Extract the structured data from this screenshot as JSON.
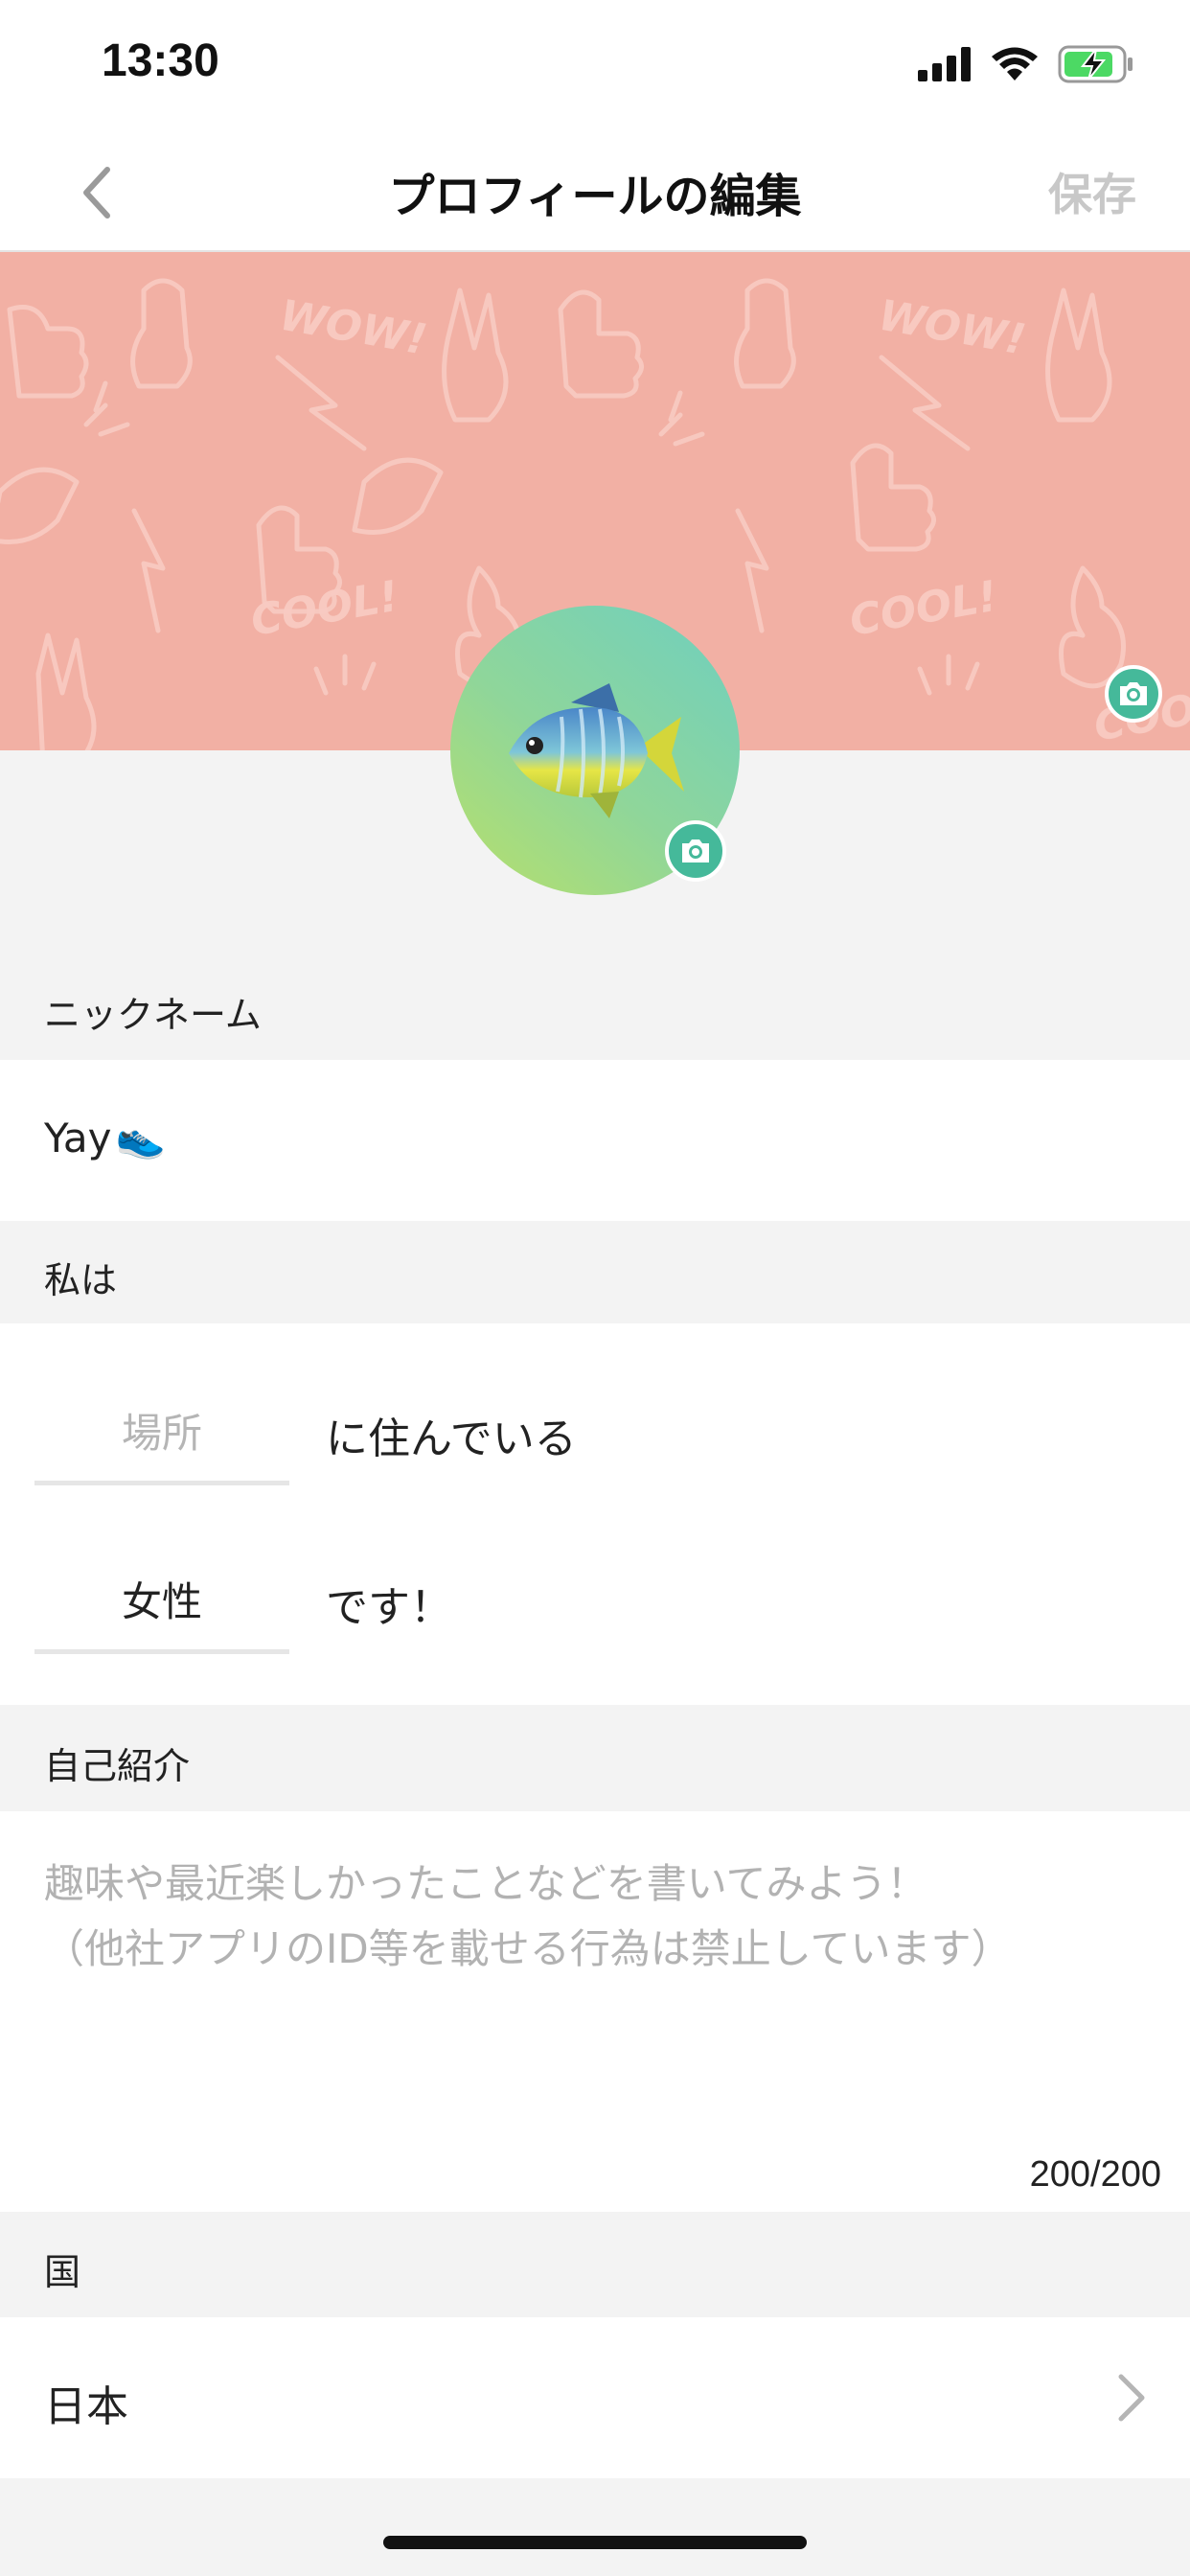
{
  "status_bar": {
    "time": "13:30",
    "icons": [
      "cellular-signal-icon",
      "wifi-icon",
      "battery-charging-icon"
    ]
  },
  "header": {
    "title": "プロフィールの編集",
    "save_label": "保存",
    "back_icon": "chevron-left-icon"
  },
  "cover": {
    "pattern_words": [
      "WOW!",
      "COOL!",
      "WOW!",
      "COOL!",
      "COOL!"
    ],
    "camera_icon": "camera-icon",
    "background_color": "#f2b0a4"
  },
  "avatar": {
    "emoji": "🐠",
    "camera_icon": "camera-icon"
  },
  "nickname": {
    "label": "ニックネーム",
    "value": "Yay",
    "value_emoji": "👟"
  },
  "me": {
    "label": "私は",
    "location_placeholder": "場所",
    "location_suffix": "に住んでいる",
    "gender_value": "女性",
    "gender_suffix": "です！"
  },
  "intro": {
    "label": "自己紹介",
    "placeholder_line1": "趣味や最近楽しかったことなどを書いてみよう！",
    "placeholder_line2": "（他社アプリのID等を載せる行為は禁止しています）",
    "char_count": "200/200"
  },
  "country": {
    "label": "国",
    "value": "日本"
  },
  "colors": {
    "accent": "#45b99a",
    "save_disabled": "#c8c8c8",
    "placeholder": "#b2b2b2"
  }
}
